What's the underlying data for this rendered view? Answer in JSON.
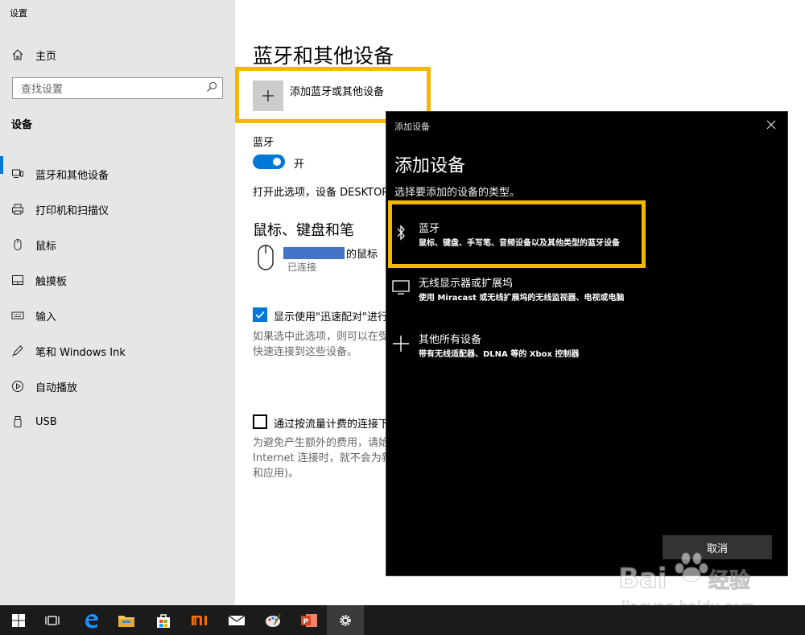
{
  "app": {
    "title": "设置"
  },
  "sidebar": {
    "home_label": "主页",
    "search_placeholder": "查找设置",
    "section": "设备",
    "items": [
      {
        "label": "蓝牙和其他设备",
        "icon": "bluetooth-devices-icon",
        "active": true
      },
      {
        "label": "打印机和扫描仪",
        "icon": "printer-icon"
      },
      {
        "label": "鼠标",
        "icon": "mouse-icon"
      },
      {
        "label": "触摸板",
        "icon": "touchpad-icon"
      },
      {
        "label": "输入",
        "icon": "keyboard-icon"
      },
      {
        "label": "笔和 Windows Ink",
        "icon": "pen-icon"
      },
      {
        "label": "自动播放",
        "icon": "autoplay-icon"
      },
      {
        "label": "USB",
        "icon": "usb-icon"
      }
    ]
  },
  "main": {
    "title": "蓝牙和其他设备",
    "add_device_label": "添加蓝牙或其他设备",
    "bluetooth_label": "蓝牙",
    "toggle_state": "开",
    "bluetooth_desc": "打开此选项，设备 DESKTOP-",
    "mouse_section_title": "鼠标、键盘和笔",
    "device_name_suffix": "的鼠标",
    "device_status": "已连接",
    "swift_pair_label": "显示使用\"迅速配对\"进行",
    "swift_pair_desc_1": "如果选中此选项，则可以在受",
    "swift_pair_desc_2": "快速连接到这些设备。",
    "metered_label": "通过按流量计费的连接下",
    "metered_desc_1": "为避免产生额外的费用，请始",
    "metered_desc_2": "Internet 连接时，就不会为新",
    "metered_desc_3": "和应用)。"
  },
  "dialog": {
    "window_title": "添加设备",
    "heading": "添加设备",
    "prompt": "选择要添加的设备的类型。",
    "options": [
      {
        "title": "蓝牙",
        "subtitle": "鼠标、键盘、手写笔、音频设备以及其他类型的蓝牙设备",
        "icon": "bluetooth-icon"
      },
      {
        "title": "无线显示器或扩展坞",
        "subtitle": "使用 Miracast 或无线扩展坞的无线监视器、电视或电脑",
        "icon": "monitor-icon"
      },
      {
        "title": "其他所有设备",
        "subtitle": "带有无线适配器、DLNA 等的 Xbox 控制器",
        "icon": "plus-icon"
      }
    ],
    "cancel_label": "取消"
  },
  "taskbar": {
    "items": [
      "start-icon",
      "task-view-icon",
      "edge-icon",
      "file-explorer-icon",
      "store-icon",
      "mi-icon",
      "mail-icon",
      "paint-icon",
      "powerpoint-icon",
      "settings-icon"
    ]
  },
  "watermark": {
    "line1": "Bai du 经验",
    "line2": "jingyan.baidu.com"
  },
  "colors": {
    "accent": "#0078d7",
    "highlight": "#f5b800",
    "dialog_bg": "#000000",
    "taskbar": "#1b1b1b"
  }
}
